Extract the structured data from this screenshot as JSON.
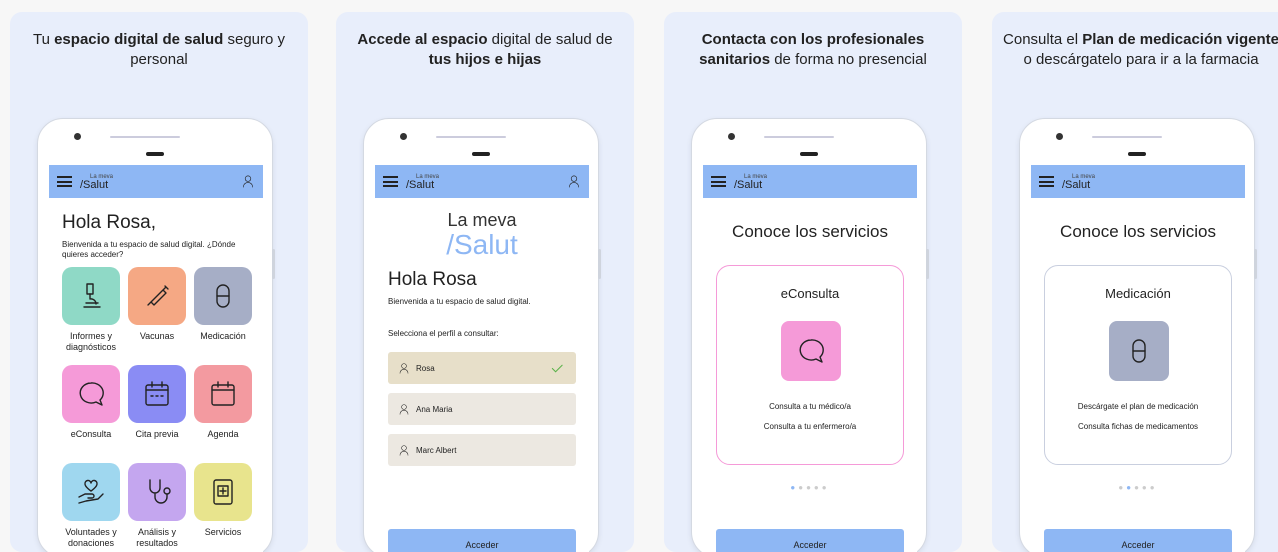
{
  "colors": {
    "accent": "#8eb7f4",
    "card_bg": "#e8eefb"
  },
  "cards": [
    {
      "caption_parts": [
        {
          "t": "Tu "
        },
        {
          "t": "espacio digital de salud",
          "b": true
        },
        {
          "t": " seguro y personal"
        }
      ],
      "logo_small_top": "La meva",
      "logo_small": "/Salut",
      "greeting": "Hola Rosa,",
      "subtitle": "Bienvenida a tu espacio de salud digital. ¿Dónde quieres acceder?",
      "tiles": [
        {
          "label": "Informes y diagnósticos",
          "icon": "microscope-icon",
          "color": "#8fd9c6"
        },
        {
          "label": "Vacunas",
          "icon": "syringe-icon",
          "color": "#f5a884"
        },
        {
          "label": "Medicación",
          "icon": "pill-icon",
          "color": "#a6aec6"
        },
        {
          "label": "eConsulta",
          "icon": "chat-icon",
          "color": "#f59ad8"
        },
        {
          "label": "Cita previa",
          "icon": "calendar-icon",
          "color": "#8a8cf4"
        },
        {
          "label": "Agenda",
          "icon": "agenda-icon",
          "color": "#f39aa0"
        },
        {
          "label": "Voluntades y donaciones",
          "icon": "hand-heart-icon",
          "color": "#9fd7ef"
        },
        {
          "label": "Análisis y resultados",
          "icon": "stethoscope-icon",
          "color": "#c4a6ef"
        },
        {
          "label": "Servicios",
          "icon": "services-icon",
          "color": "#e8e48d"
        }
      ]
    },
    {
      "caption_parts": [
        {
          "t": "Accede al espacio",
          "b": true
        },
        {
          "t": " digital de salud de "
        },
        {
          "t": "tus hijos e hijas",
          "b": true
        }
      ],
      "logo_small_top": "La meva",
      "logo_small": "/Salut",
      "logo_big_1": "La meva",
      "logo_big_2": "/Salut",
      "greeting": "Hola Rosa",
      "subtitle": "Bienvenida a tu espacio de salud digital.",
      "select_label": "Selecciona el perfil a consultar:",
      "profiles": [
        "Rosa",
        "Ana Maria",
        "Marc Albert"
      ],
      "selected_profile": "Rosa",
      "button": "Acceder"
    },
    {
      "caption_parts": [
        {
          "t": "Contacta con los profesionales sanitarios",
          "b": true
        },
        {
          "t": " de forma no presencial"
        }
      ],
      "logo_small_top": "La meva",
      "logo_small": "/Salut",
      "title": "Conoce los servicios",
      "service": "eConsulta",
      "lines": [
        "Consulta a tu médico/a",
        "Consulta a tu enfermero/a"
      ],
      "icon": "chat-icon",
      "icon_color": "#f59ad8",
      "border_color": "#f59ad8",
      "active_dot": 0,
      "button": "Acceder"
    },
    {
      "caption_parts": [
        {
          "t": "Consulta el "
        },
        {
          "t": "Plan de medicación vigente",
          "b": true
        },
        {
          "t": " o descárgatelo para ir a la farmacia"
        }
      ],
      "logo_small_top": "La meva",
      "logo_small": "/Salut",
      "title": "Conoce los servicios",
      "service": "Medicación",
      "lines": [
        "Descárgate el plan de medicación",
        "Consulta fichas de medicamentos"
      ],
      "icon": "pill-icon",
      "icon_color": "#a6aec6",
      "border_color": "#c9cfdf",
      "active_dot": 1,
      "button": "Acceder"
    }
  ]
}
